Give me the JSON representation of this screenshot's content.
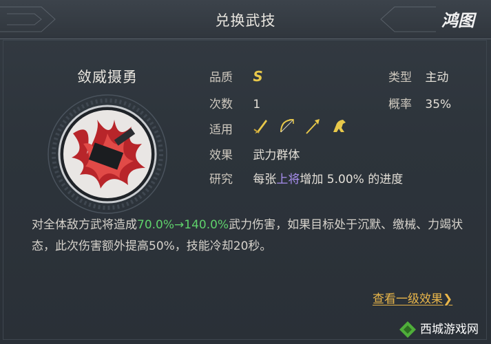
{
  "header": {
    "title": "兑换武技",
    "logo_text": "鸿图"
  },
  "skill": {
    "name": "敛威摄勇",
    "quality_label": "品质",
    "quality_value": "S",
    "type_label": "类型",
    "type_value": "主动",
    "count_label": "次数",
    "count_value": "1",
    "rate_label": "概率",
    "rate_value": "35%",
    "applies_label": "适用",
    "applies_icons": [
      "sword-icon",
      "bow-icon",
      "spear-icon",
      "horse-icon"
    ],
    "effect_label": "效果",
    "effect_value": "武力群体",
    "research_label": "研究",
    "research_prefix": "每张",
    "research_highlight": "上将",
    "research_suffix": "增加 5.00% 的进度"
  },
  "description": {
    "part1": "对全体敌方武将造成",
    "highlight": "70.0%→140.0%",
    "part2": "武力伤害，如果目标处于沉默、缴械、力竭状态，此次伤害额外提高50%，技能冷却20秒。"
  },
  "link": {
    "label": "查看一级效果❯"
  },
  "watermark": {
    "text": "西城游戏网"
  },
  "colors": {
    "grade": "#e8c84a",
    "highlight_green": "#5fd16b",
    "highlight_purple": "#a98ff0",
    "link": "#e9b64a"
  }
}
